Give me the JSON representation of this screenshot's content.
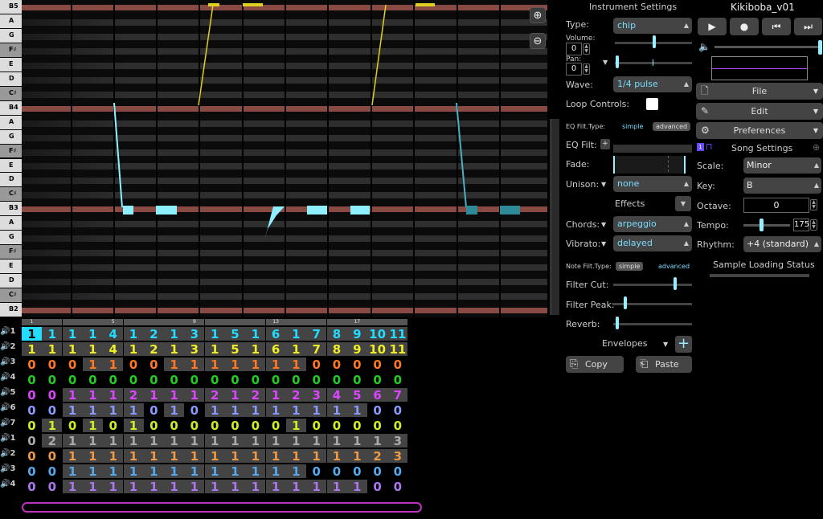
{
  "piano": {
    "keys": [
      "B5",
      "A",
      "G",
      "F♯",
      "E",
      "D",
      "C♯",
      "B4",
      "A",
      "G",
      "F♯",
      "E",
      "D",
      "C♯",
      "B3",
      "A",
      "G",
      "F♯",
      "E",
      "D",
      "C♯",
      "B2"
    ],
    "zoom_in": "⊕",
    "zoom_out": "⊖"
  },
  "pattern": {
    "column_numbers": [
      "1",
      "",
      "",
      "",
      "5",
      "",
      "",
      "",
      "9",
      "",
      "",
      "",
      "13",
      "",
      "",
      "",
      "17",
      "",
      ""
    ],
    "channels": [
      {
        "num": "1",
        "color": "#22ddff",
        "values": [
          "1",
          "1",
          "1",
          "1",
          "4",
          "1",
          "2",
          "1",
          "3",
          "1",
          "5",
          "1",
          "6",
          "1",
          "7",
          "8",
          "9",
          "10",
          "11"
        ]
      },
      {
        "num": "2",
        "color": "#eeee22",
        "values": [
          "1",
          "1",
          "1",
          "1",
          "4",
          "1",
          "2",
          "1",
          "3",
          "1",
          "5",
          "1",
          "6",
          "1",
          "7",
          "8",
          "9",
          "10",
          "11"
        ]
      },
      {
        "num": "3",
        "color": "#ff7722",
        "values": [
          "0",
          "0",
          "0",
          "1",
          "1",
          "0",
          "0",
          "1",
          "1",
          "1",
          "1",
          "1",
          "1",
          "1",
          "0",
          "0",
          "0",
          "0",
          "0"
        ]
      },
      {
        "num": "4",
        "color": "#22cc22",
        "values": [
          "0",
          "0",
          "0",
          "0",
          "0",
          "0",
          "0",
          "0",
          "0",
          "0",
          "0",
          "0",
          "0",
          "0",
          "0",
          "0",
          "0",
          "0",
          "0"
        ]
      },
      {
        "num": "5",
        "color": "#dd44ff",
        "values": [
          "0",
          "0",
          "1",
          "1",
          "1",
          "2",
          "1",
          "1",
          "1",
          "2",
          "1",
          "2",
          "1",
          "2",
          "3",
          "4",
          "5",
          "6",
          "7"
        ]
      },
      {
        "num": "6",
        "color": "#8899ff",
        "values": [
          "0",
          "0",
          "1",
          "1",
          "1",
          "1",
          "0",
          "1",
          "0",
          "1",
          "1",
          "1",
          "1",
          "1",
          "1",
          "1",
          "1",
          "0",
          "0"
        ]
      },
      {
        "num": "7",
        "color": "#ccee22",
        "values": [
          "0",
          "1",
          "0",
          "1",
          "0",
          "1",
          "0",
          "0",
          "0",
          "0",
          "0",
          "0",
          "0",
          "1",
          "0",
          "0",
          "0",
          "0",
          "0"
        ]
      },
      {
        "num": "1",
        "color": "#aaaaaa",
        "values": [
          "0",
          "2",
          "1",
          "1",
          "1",
          "1",
          "1",
          "1",
          "1",
          "1",
          "1",
          "1",
          "1",
          "1",
          "1",
          "1",
          "1",
          "1",
          "3"
        ]
      },
      {
        "num": "2",
        "color": "#ee9944",
        "values": [
          "0",
          "0",
          "1",
          "1",
          "1",
          "1",
          "1",
          "1",
          "1",
          "1",
          "1",
          "1",
          "1",
          "1",
          "1",
          "1",
          "1",
          "2",
          "3"
        ]
      },
      {
        "num": "3",
        "color": "#55aaee",
        "values": [
          "0",
          "0",
          "1",
          "1",
          "1",
          "1",
          "1",
          "1",
          "1",
          "1",
          "1",
          "1",
          "1",
          "1",
          "0",
          "0",
          "0",
          "0",
          "0"
        ]
      },
      {
        "num": "4",
        "color": "#aa77ee",
        "values": [
          "0",
          "0",
          "1",
          "1",
          "1",
          "1",
          "1",
          "1",
          "1",
          "1",
          "1",
          "1",
          "1",
          "1",
          "1",
          "1",
          "1",
          "0",
          "0"
        ]
      }
    ]
  },
  "instrument": {
    "title": "Instrument Settings",
    "type_label": "Type:",
    "type_value": "chip",
    "volume_label": "Volume:",
    "volume_value": "0",
    "pan_label": "Pan:",
    "pan_value": "0",
    "wave_label": "Wave:",
    "wave_value": "1/4 pulse",
    "loop_label": "Loop Controls:",
    "eq_type_label": "EQ Filt.Type:",
    "eq_simple": "simple",
    "eq_advanced": "advanced",
    "eq_filt_label": "EQ Filt:",
    "fade_label": "Fade:",
    "unison_label": "Unison:",
    "unison_value": "none",
    "effects_label": "Effects",
    "chords_label": "Chords:",
    "chords_value": "arpeggio",
    "vibrato_label": "Vibrato:",
    "vibrato_value": "delayed",
    "note_type_label": "Note Filt.Type:",
    "note_simple": "simple",
    "note_advanced": "advanced",
    "filter_cut_label": "Filter Cut:",
    "filter_peak_label": "Filter Peak:",
    "reverb_label": "Reverb:",
    "envelopes_label": "Envelopes",
    "copy_label": "Copy",
    "paste_label": "Paste"
  },
  "song": {
    "title": "Kikiboba_v01",
    "file_label": "File",
    "edit_label": "Edit",
    "prefs_label": "Preferences",
    "song_settings_label": "Song Settings",
    "scale_label": "Scale:",
    "scale_value": "Minor",
    "key_label": "Key:",
    "key_value": "B",
    "octave_label": "Octave:",
    "octave_value": "0",
    "tempo_label": "Tempo:",
    "tempo_value": "175",
    "rhythm_label": "Rhythm:",
    "rhythm_value": "+4 (standard)",
    "sample_status_label": "Sample Loading Status"
  },
  "colors": {
    "accent": "#9ef",
    "note_color": "#8ef0ff",
    "highlight_row": "#8a4a44",
    "scrollbar": "#c030c0"
  }
}
